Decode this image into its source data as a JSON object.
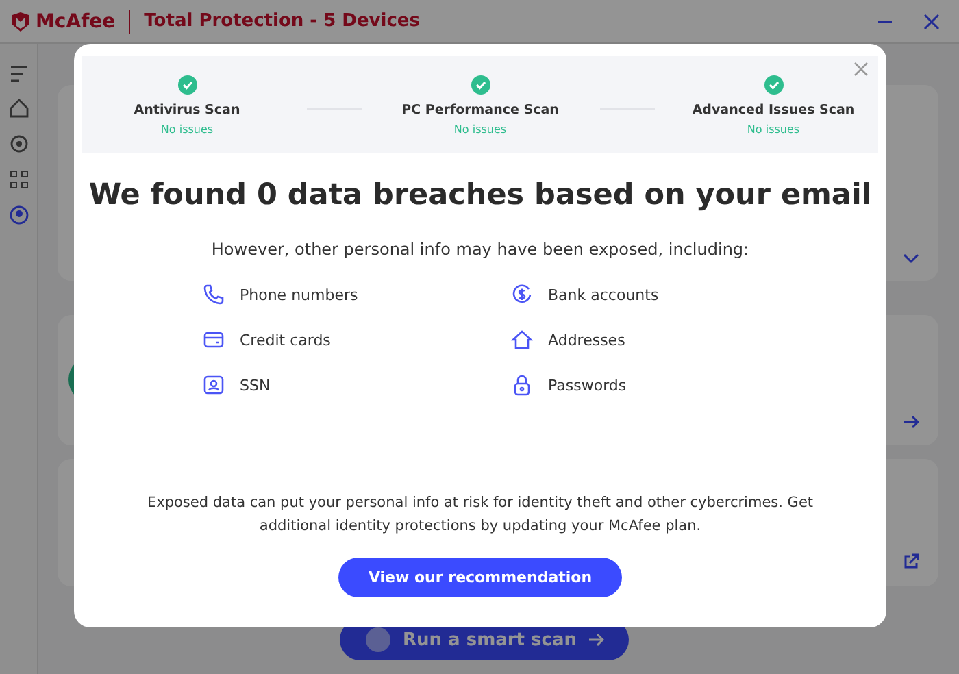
{
  "window": {
    "brand": "McAfee",
    "title": "Total Protection - 5 Devices"
  },
  "background": {
    "scan_button": "Run a smart scan"
  },
  "dialog": {
    "scans": [
      {
        "label": "Antivirus Scan",
        "status": "No issues",
        "done": true
      },
      {
        "label": "PC Performance Scan",
        "status": "No issues",
        "done": true
      },
      {
        "label": "Advanced Issues Scan",
        "status": "No issues",
        "done": true
      }
    ],
    "heading": "We found 0 data breaches based on your email",
    "subheading": "However, other personal info may have been exposed, including:",
    "items": [
      {
        "kind": "phone",
        "label": "Phone numbers"
      },
      {
        "kind": "bank",
        "label": "Bank accounts"
      },
      {
        "kind": "card",
        "label": "Credit cards"
      },
      {
        "kind": "home",
        "label": "Addresses"
      },
      {
        "kind": "id",
        "label": "SSN"
      },
      {
        "kind": "lock",
        "label": "Passwords"
      }
    ],
    "note": "Exposed data can put your personal info at risk for identity theft and other cybercrimes. Get additional identity protections by updating your McAfee plan.",
    "button": "View our recommendation"
  }
}
